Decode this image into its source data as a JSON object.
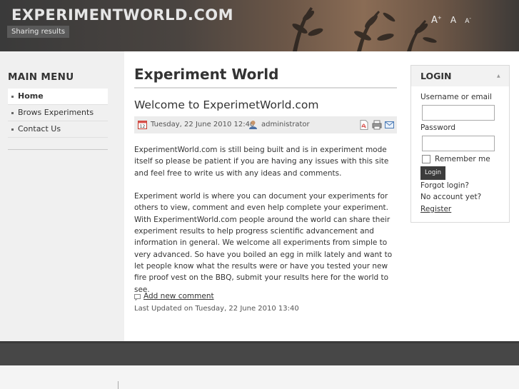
{
  "header": {
    "site_title": "EXPERIMENTWORLD.COM",
    "tagline": "Sharing results",
    "font_sizer": {
      "increase": "A",
      "default": "A",
      "decrease": "A"
    }
  },
  "sidebar": {
    "title": "MAIN MENU",
    "items": [
      {
        "label": "Home",
        "active": true
      },
      {
        "label": "Brows Experiments",
        "active": false
      },
      {
        "label": "Contact Us",
        "active": false
      }
    ]
  },
  "main": {
    "page_title": "Experiment World",
    "article": {
      "title": "Welcome to ExperimetWorld.com",
      "date": "Tuesday, 22 June 2010 12:40",
      "author": "administrator",
      "paragraphs": [
        "ExperimentWorld.com is still being built and is in experiment mode itself so please be patient if you are having any issues with this site and feel free to write us with any ideas and comments.",
        "Experiment world is where you can document your experiments for others to view, comment and even help complete your experiment. With ExperimentWorld.com people around the world can share their experiment results to help progress scientific advancement and information in general. We welcome all experiments from simple to very advanced. So have you boiled an egg in milk lately and want to let people know what the results were or have you tested your new fire proof vest on the BBQ, submit your results here for the world to see."
      ],
      "add_comment": "Add new comment",
      "last_updated": "Last Updated on Tuesday, 22 June 2010 13:40"
    }
  },
  "login": {
    "title": "LOGIN",
    "username_label": "Username or email",
    "password_label": "Password",
    "remember_label": "Remember me",
    "button_label": "Login",
    "forgot_link": "Forgot login?",
    "no_account_text": "No account yet?",
    "register_link": "Register"
  },
  "icons": {
    "calendar": "calendar-icon",
    "author": "user-icon",
    "pdf": "pdf-icon",
    "print": "print-icon",
    "email": "email-icon",
    "comment": "comment-icon"
  },
  "colors": {
    "footer_band": "#474747",
    "sidebar_bg": "#f0f0f0",
    "login_button": "#3c3c3c"
  }
}
